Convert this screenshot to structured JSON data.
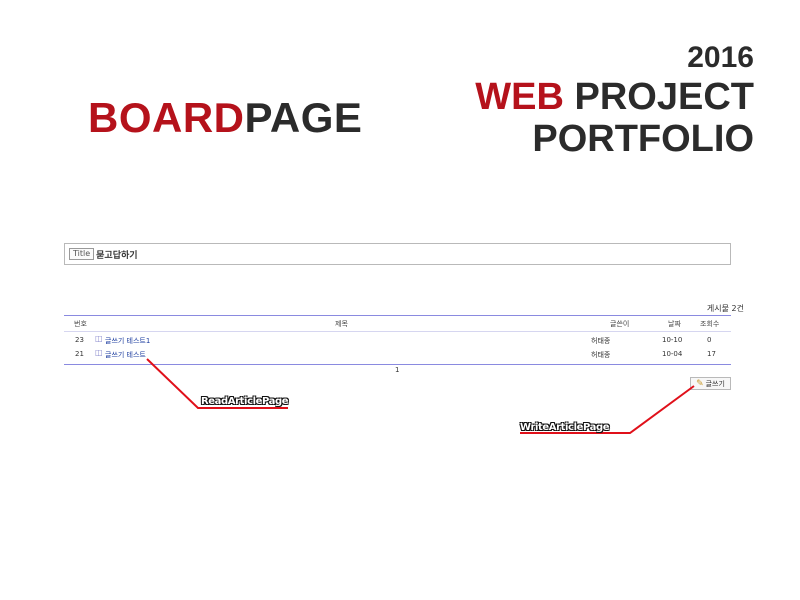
{
  "header_left": {
    "part1": "BOARD",
    "part2": "PAGE"
  },
  "header_right": {
    "year": "2016",
    "line1_red": "WEB",
    "line1_rest": "PROJECT",
    "line2": "PORTFOLIO"
  },
  "title_box": {
    "tag": "Title",
    "text": "묻고답하기"
  },
  "board": {
    "count_text": "게시물 2건",
    "columns": [
      "번호",
      "제목",
      "글쓴이",
      "날짜",
      "조회수"
    ],
    "rows": [
      {
        "num": "23",
        "title": "글쓰기 테스트1",
        "writer": "허태종",
        "date": "10-10",
        "views": "0"
      },
      {
        "num": "21",
        "title": "글쓰기 테스트",
        "writer": "허태종",
        "date": "10-04",
        "views": "17"
      }
    ],
    "pager": "1",
    "write_button": "글쓰기"
  },
  "annotations": {
    "read": "ReadArticlePage",
    "write": "WriteArticlePage"
  },
  "colors": {
    "brand_red": "#b5121b",
    "annotation_red": "#e0101a",
    "board_border": "#8a8ae0"
  },
  "icons": {
    "article": "article-icon",
    "pen": "pen-icon"
  }
}
